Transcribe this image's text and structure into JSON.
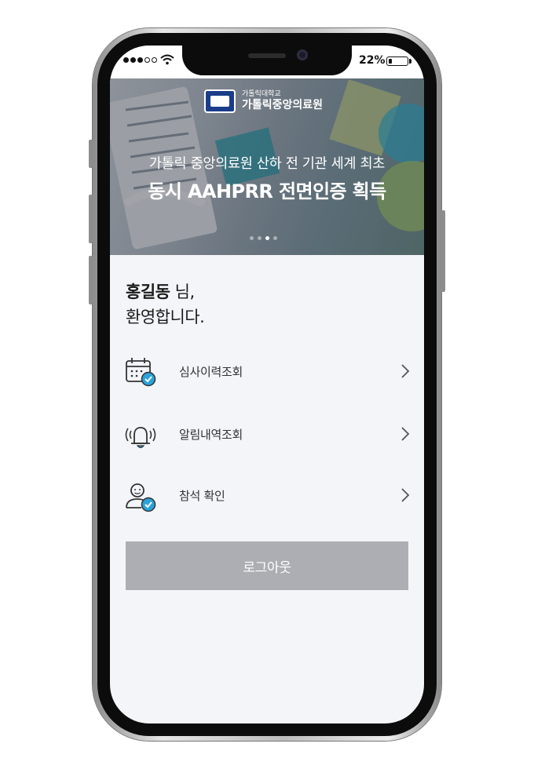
{
  "status_bar": {
    "battery_percent": "22%",
    "battery_level": 0.22
  },
  "banner": {
    "logo_small": "가톨릭대학교",
    "logo_big": "가톨릭중앙의료원",
    "subtitle": "가톨릭 중앙의료원 산하 전 기관 세계 최초",
    "title": "동시 AAHPRR 전면인증 획득",
    "pager": {
      "count": 4,
      "active_index": 2
    }
  },
  "greeting": {
    "user_name": "홍길동",
    "honorific": " 님,",
    "welcome": "환영합니다."
  },
  "menu": {
    "items": [
      {
        "label": "심사이력조회",
        "icon": "calendar-check-icon"
      },
      {
        "label": "알림내역조회",
        "icon": "alarm-bell-icon"
      },
      {
        "label": "참석 확인",
        "icon": "user-check-icon"
      }
    ]
  },
  "logout_label": "로그아웃",
  "colors": {
    "accent": "#2aa3d8",
    "logout_bg": "#acaeb3",
    "screen_bg": "#f4f5f9"
  }
}
